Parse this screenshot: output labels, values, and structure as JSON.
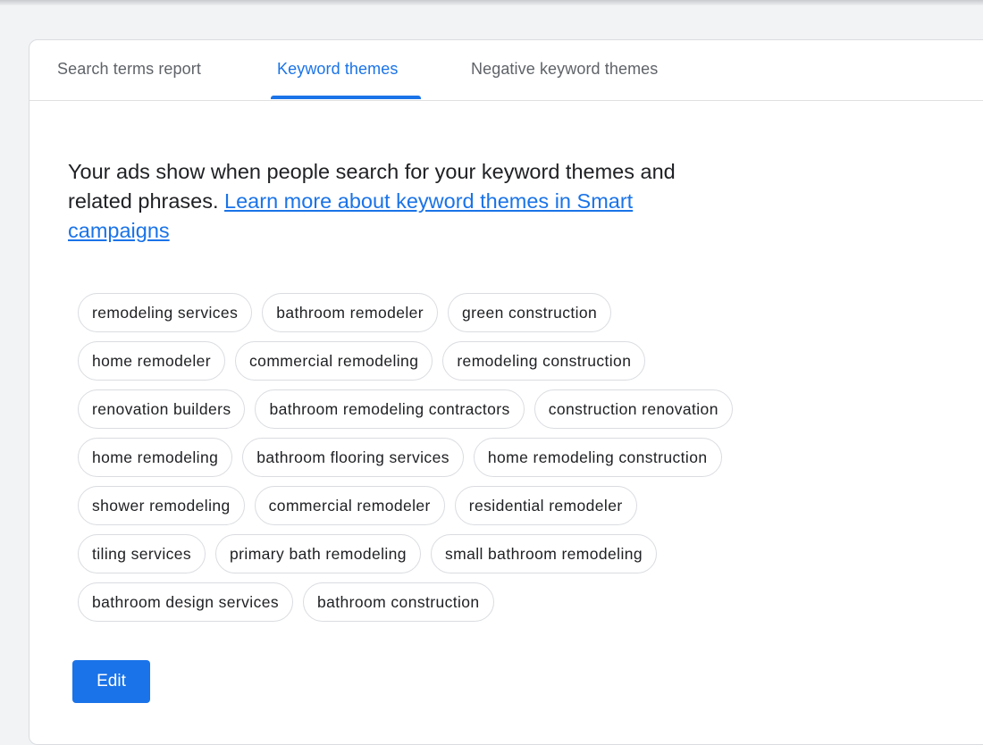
{
  "tabs": [
    {
      "label": "Search terms report",
      "active": false
    },
    {
      "label": "Keyword themes",
      "active": true
    },
    {
      "label": "Negative keyword themes",
      "active": false
    }
  ],
  "description": {
    "text": "Your ads show when people search for your keyword themes and related phrases. ",
    "link_text": "Learn more about keyword themes in Smart campaigns"
  },
  "keyword_themes": [
    [
      "remodeling services",
      "bathroom remodeler",
      "green construction"
    ],
    [
      "home remodeler",
      "commercial remodeling",
      "remodeling construction"
    ],
    [
      "renovation builders",
      "bathroom remodeling contractors",
      "construction renovation"
    ],
    [
      "home remodeling",
      "bathroom flooring services",
      "home remodeling construction"
    ],
    [
      "shower remodeling",
      "commercial remodeler",
      "residential remodeler"
    ],
    [
      "tiling services",
      "primary bath remodeling",
      "small bathroom remodeling"
    ],
    [
      "bathroom design services",
      "bathroom construction"
    ]
  ],
  "edit_button": {
    "label": "Edit"
  },
  "colors": {
    "accent": "#1a73e8",
    "page_background": "#f1f3f4",
    "chip_border": "#dadce0",
    "text": "#202124",
    "tab_inactive": "#5f6368"
  }
}
